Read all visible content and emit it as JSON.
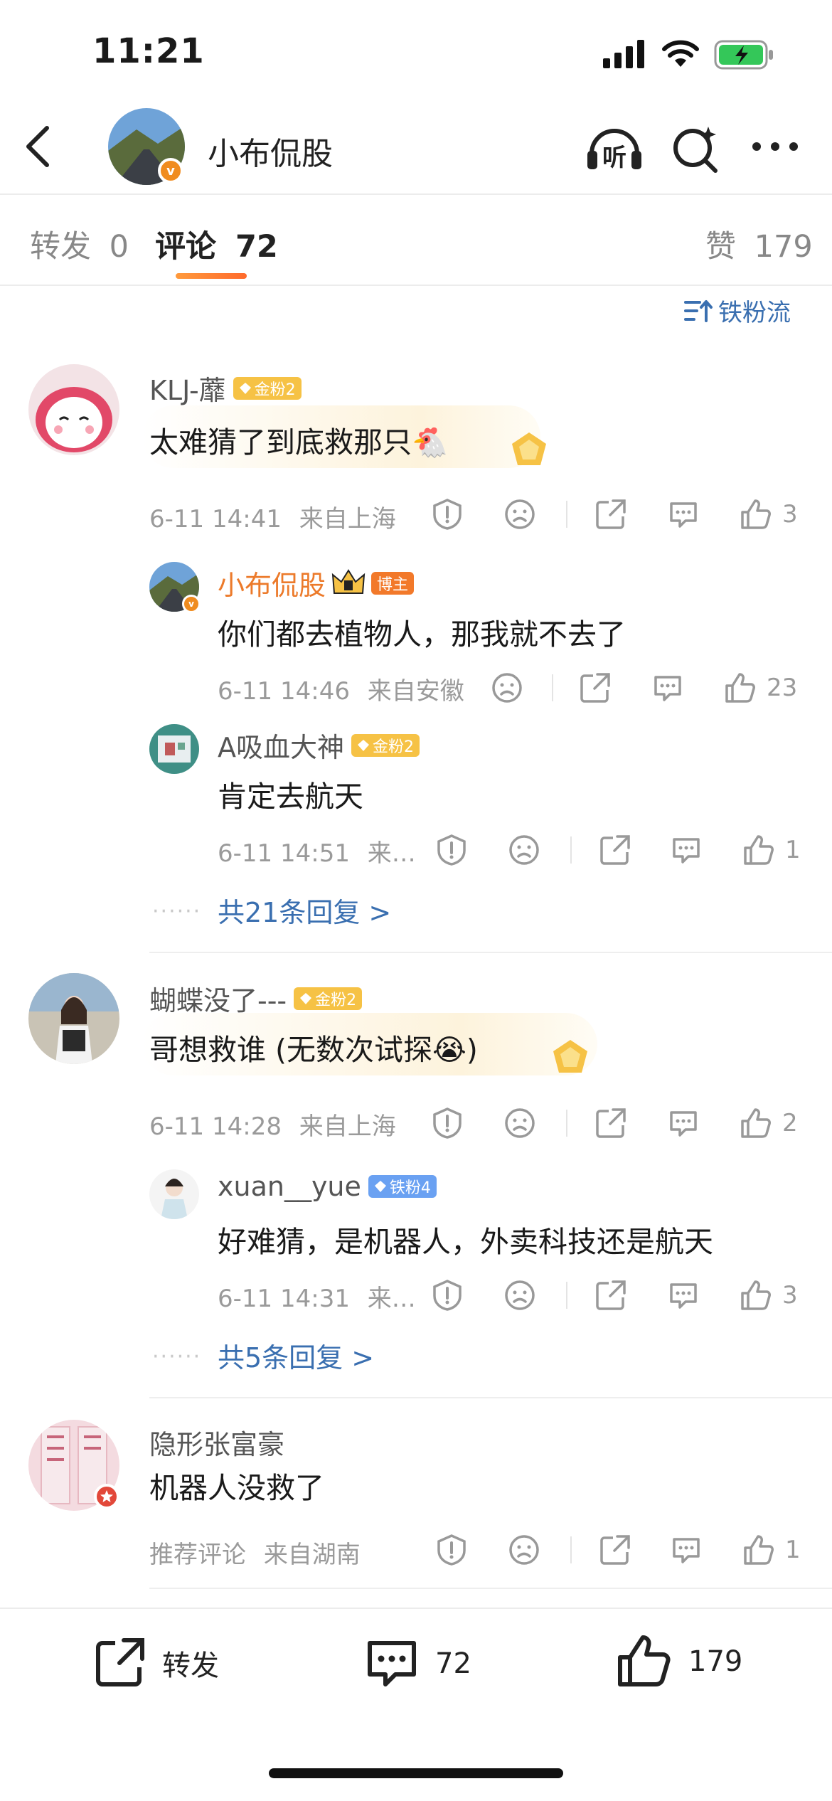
{
  "status": {
    "time": "11:21"
  },
  "header": {
    "name": "小布侃股",
    "verified": "v",
    "listen_icon_text": "听"
  },
  "tabs": [
    {
      "label": "转发",
      "count": "0"
    },
    {
      "label": "评论",
      "count": "72"
    },
    {
      "label": "赞",
      "count": "179"
    }
  ],
  "sort": {
    "label": "铁粉流"
  },
  "comments": [
    {
      "user": "KLJ-蘼",
      "badge": "金粉2",
      "text": "太难猜了到底救那只🐔",
      "time": "6-11 14:41",
      "loc": "来自上海",
      "likes": "3",
      "replies": [
        {
          "user": "小布侃股",
          "badge": "博主",
          "text": "你们都去植物人，那我就不去了",
          "time": "6-11 14:46",
          "loc": "来自安徽",
          "likes": "23"
        },
        {
          "user": "A吸血大神",
          "badge": "金粉2",
          "text": "肯定去航天",
          "time": "6-11 14:51",
          "loc": "来…",
          "likes": "1"
        }
      ],
      "more": "共21条回复 >"
    },
    {
      "user": "蝴蝶没了---",
      "badge": "金粉2",
      "text": "哥想救谁 (无数次试探😭)",
      "time": "6-11 14:28",
      "loc": "来自上海",
      "likes": "2",
      "replies": [
        {
          "user": "xuan__yue",
          "badge": "铁粉4",
          "text": "好难猜，是机器人，外卖科技还是航天",
          "time": "6-11 14:31",
          "loc": "来…",
          "likes": "3"
        }
      ],
      "more": "共5条回复 >"
    },
    {
      "user": "隐形张富豪",
      "text": "机器人没救了",
      "time": "推荐评论",
      "loc": "来自湖南",
      "likes": "1"
    }
  ],
  "bottom": {
    "repost": "转发",
    "comments": "72",
    "likes": "179"
  },
  "colors": {
    "accent": "#f08c1f",
    "link": "#3a6fb0",
    "gold_badge": "#f6c245",
    "iron_badge": "#6aa1f2"
  }
}
